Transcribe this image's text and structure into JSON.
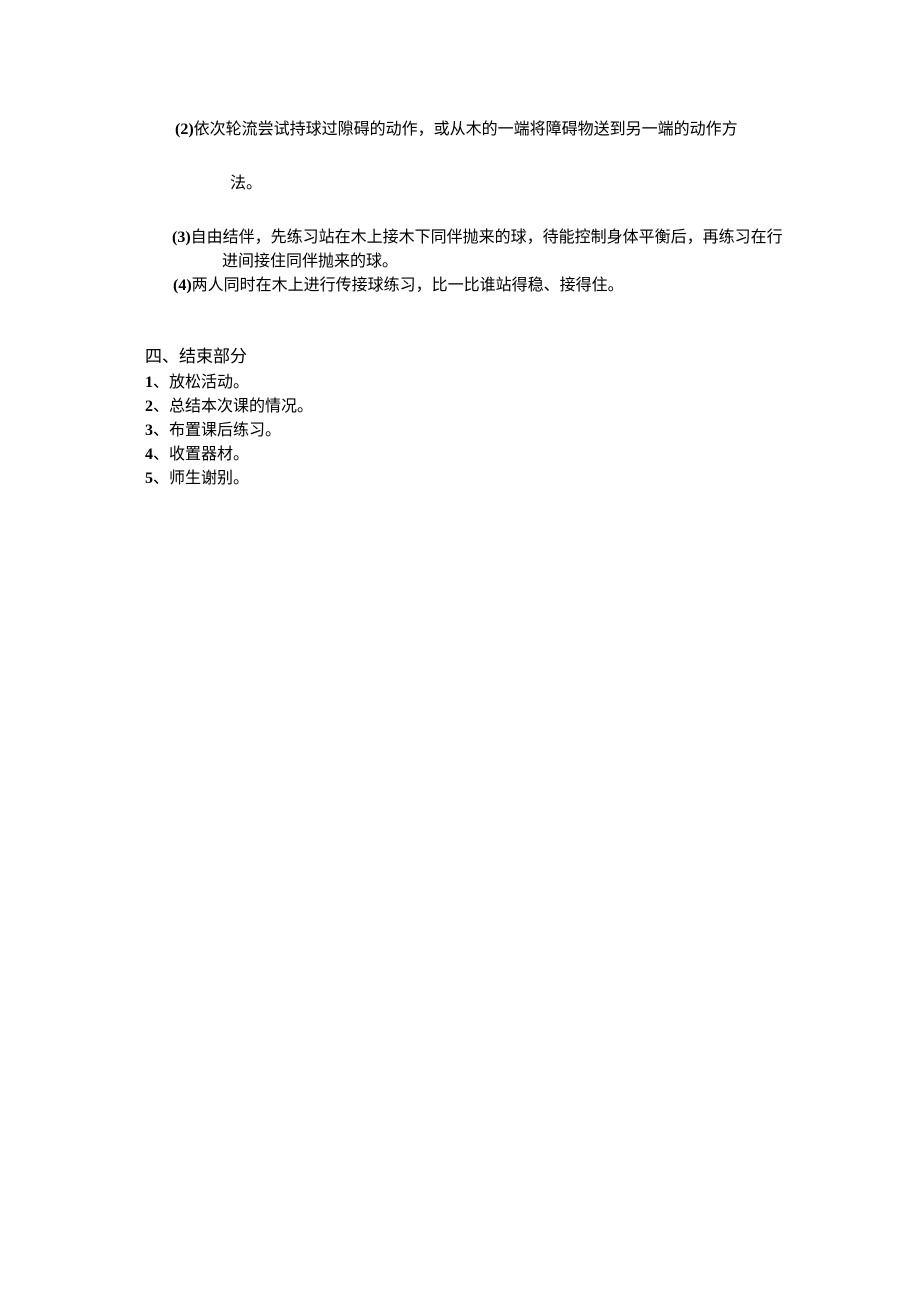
{
  "item2": {
    "marker": "(2)",
    "line1": "依次轮流尝试持球过隙碍的动作，或从木的一端将障碍物送到另一端的动作方",
    "line2": "法。"
  },
  "item3": {
    "marker": "(3)",
    "line1": "自由结伴，先练习站在木上接木下同伴抛来的球，待能控制身体平衡后，再练习在行",
    "line2": "进间接住同伴抛来的球。"
  },
  "item4": {
    "marker": "(4)",
    "text": "两人同时在木上进行传接球练习，比一比谁站得稳、接得住。"
  },
  "section4": {
    "title": "四、结束部分",
    "items": [
      {
        "num": "1",
        "sep": "、",
        "text": "放松活动。"
      },
      {
        "num": "2",
        "sep": "、",
        "text": "总结本次课的情况。"
      },
      {
        "num": "3",
        "sep": "、",
        "text": "布置课后练习。"
      },
      {
        "num": "4",
        "sep": "、",
        "text": "收置器材。"
      },
      {
        "num": "5",
        "sep": "、",
        "text": "师生谢别。"
      }
    ]
  }
}
